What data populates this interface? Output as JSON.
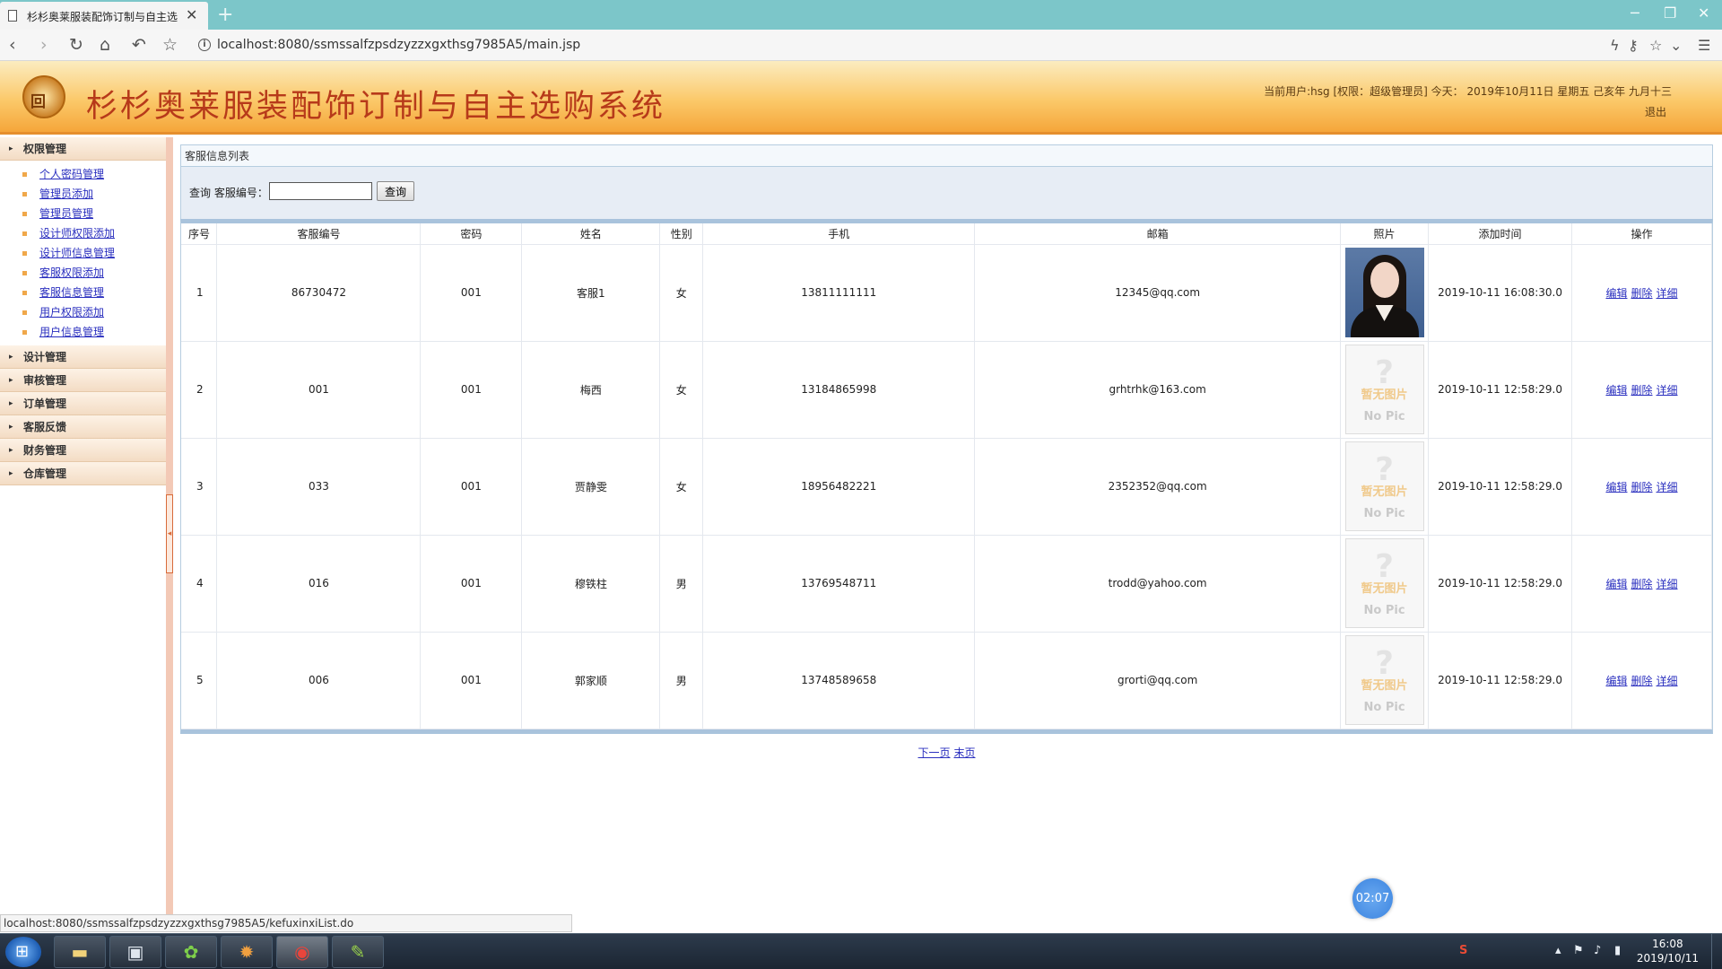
{
  "browser": {
    "tab_title": "杉杉奥莱服装配饰订制与自主选",
    "url": "localhost:8080/ssmssalfzpsdzyzzxgxthsg7985A5/main.jsp",
    "status_url": "localhost:8080/ssmssalfzpsdzyzzxgxthsg7985A5/kefuxinxiList.do"
  },
  "header": {
    "logo_text": "回",
    "title": "杉杉奥莱服装配饰订制与自主选购系统",
    "user_info": "当前用户:hsg [权限：超级管理员] 今天： 2019年10月11日 星期五 己亥年 九月十三",
    "logout": "退出"
  },
  "sidebar": {
    "groups": [
      {
        "label": "权限管理",
        "items": [
          "个人密码管理",
          "管理员添加",
          "管理员管理",
          "设计师权限添加",
          "设计师信息管理",
          "客服权限添加",
          "客服信息管理",
          "用户权限添加",
          "用户信息管理"
        ]
      },
      {
        "label": "设计管理"
      },
      {
        "label": "审核管理"
      },
      {
        "label": "订单管理"
      },
      {
        "label": "客服反馈"
      },
      {
        "label": "财务管理"
      },
      {
        "label": "仓库管理"
      }
    ]
  },
  "main": {
    "panel_title": "客服信息列表",
    "search": {
      "label": "查询 客服编号：",
      "value": "",
      "button": "查询"
    },
    "columns": [
      "序号",
      "客服编号",
      "密码",
      "姓名",
      "性别",
      "手机",
      "邮箱",
      "照片",
      "添加时间",
      "操作"
    ],
    "rows": [
      {
        "idx": "1",
        "code": "86730472",
        "pwd": "001",
        "name": "客服1",
        "gender": "女",
        "phone": "13811111111",
        "email": "12345@qq.com",
        "photo": "real",
        "time": "2019-10-11 16:08:30.0"
      },
      {
        "idx": "2",
        "code": "001",
        "pwd": "001",
        "name": "梅西",
        "gender": "女",
        "phone": "13184865998",
        "email": "grhtrhk@163.com",
        "photo": "nopic",
        "time": "2019-10-11 12:58:29.0"
      },
      {
        "idx": "3",
        "code": "033",
        "pwd": "001",
        "name": "贾静雯",
        "gender": "女",
        "phone": "18956482221",
        "email": "2352352@qq.com",
        "photo": "nopic",
        "time": "2019-10-11 12:58:29.0"
      },
      {
        "idx": "4",
        "code": "016",
        "pwd": "001",
        "name": "穆铁柱",
        "gender": "男",
        "phone": "13769548711",
        "email": "trodd@yahoo.com",
        "photo": "nopic",
        "time": "2019-10-11 12:58:29.0"
      },
      {
        "idx": "5",
        "code": "006",
        "pwd": "001",
        "name": "郭家顺",
        "gender": "男",
        "phone": "13748589658",
        "email": "grorti@qq.com",
        "photo": "nopic",
        "time": "2019-10-11 12:58:29.0"
      }
    ],
    "nopic": {
      "zh": "暂无图片",
      "en": "No Pic",
      "q": "?"
    },
    "ops": {
      "edit": "编辑",
      "delete": "删除",
      "detail": "详细"
    },
    "pager": {
      "next": "下一页",
      "last": "末页"
    }
  },
  "timer": "02:07",
  "taskbar": {
    "time": "16:08",
    "date": "2019/10/11"
  },
  "colors": {
    "header_title": "#b73a1a",
    "link": "#2a2fbf",
    "tab_bar": "#7cc6c9"
  }
}
